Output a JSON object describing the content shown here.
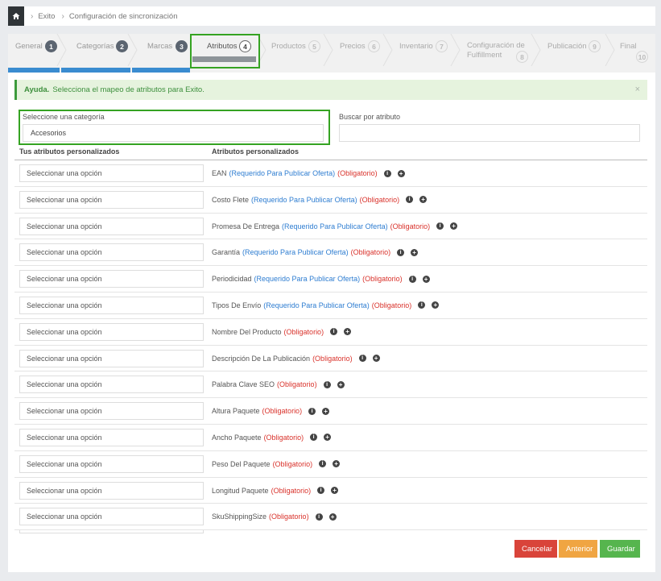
{
  "breadcrumb": {
    "items": [
      "Exito",
      "Configuración de sincronización"
    ]
  },
  "steps": [
    {
      "label": "General",
      "badge": "1",
      "state": "done"
    },
    {
      "label": "Categorías",
      "badge": "2",
      "state": "done"
    },
    {
      "label": "Marcas",
      "badge": "3",
      "state": "done"
    },
    {
      "label": "Atributos",
      "badge": "4",
      "state": "active"
    },
    {
      "label": "Productos",
      "badge": "5",
      "state": "todo"
    },
    {
      "label": "Precios",
      "badge": "6",
      "state": "todo"
    },
    {
      "label": "Inventario",
      "badge": "7",
      "state": "todo"
    },
    {
      "label": "Configuración de Fulfillment",
      "badge": "8",
      "state": "todo"
    },
    {
      "label": "Publicación",
      "badge": "9",
      "state": "todo"
    },
    {
      "label": "Final",
      "badge": "10",
      "state": "todo"
    }
  ],
  "alert": {
    "title": "Ayuda.",
    "text": "Selecciona el mapeo de atributos para Exito.",
    "close": "×"
  },
  "category": {
    "label": "Seleccione una categoría",
    "value": "Accesorios"
  },
  "search": {
    "label": "Buscar por atributo",
    "value": "",
    "placeholder": ""
  },
  "columns": {
    "left": "Tus atributos personalizados",
    "right": "Atributos personalizados"
  },
  "option_placeholder": "Seleccionar una opción",
  "req_publish": "(Requerido Para Publicar Oferta)",
  "req_mandatory": "(Obligatorio)",
  "rows": [
    {
      "name": "EAN",
      "publish": true
    },
    {
      "name": "Costo Flete",
      "publish": true
    },
    {
      "name": "Promesa De Entrega",
      "publish": true
    },
    {
      "name": "Garantía",
      "publish": true
    },
    {
      "name": "Periodicidad",
      "publish": true
    },
    {
      "name": "Tipos De Envío",
      "publish": true
    },
    {
      "name": "Nombre Del Producto",
      "publish": false
    },
    {
      "name": "Descripción De La Publicación",
      "publish": false
    },
    {
      "name": "Palabra Clave SEO",
      "publish": false
    },
    {
      "name": "Altura Paquete",
      "publish": false
    },
    {
      "name": "Ancho Paquete",
      "publish": false
    },
    {
      "name": "Peso Del Paquete",
      "publish": false
    },
    {
      "name": "Longitud Paquete",
      "publish": false
    },
    {
      "name": "SkuShippingSize",
      "publish": false
    }
  ],
  "buttons": {
    "cancel": "Cancelar",
    "prev": "Anterior",
    "save": "Guardar"
  },
  "colors": {
    "accent_blue": "#3a8cd0",
    "highlight_green": "#35a322",
    "required_red": "#d9322b",
    "link_blue": "#2e7dd1"
  }
}
